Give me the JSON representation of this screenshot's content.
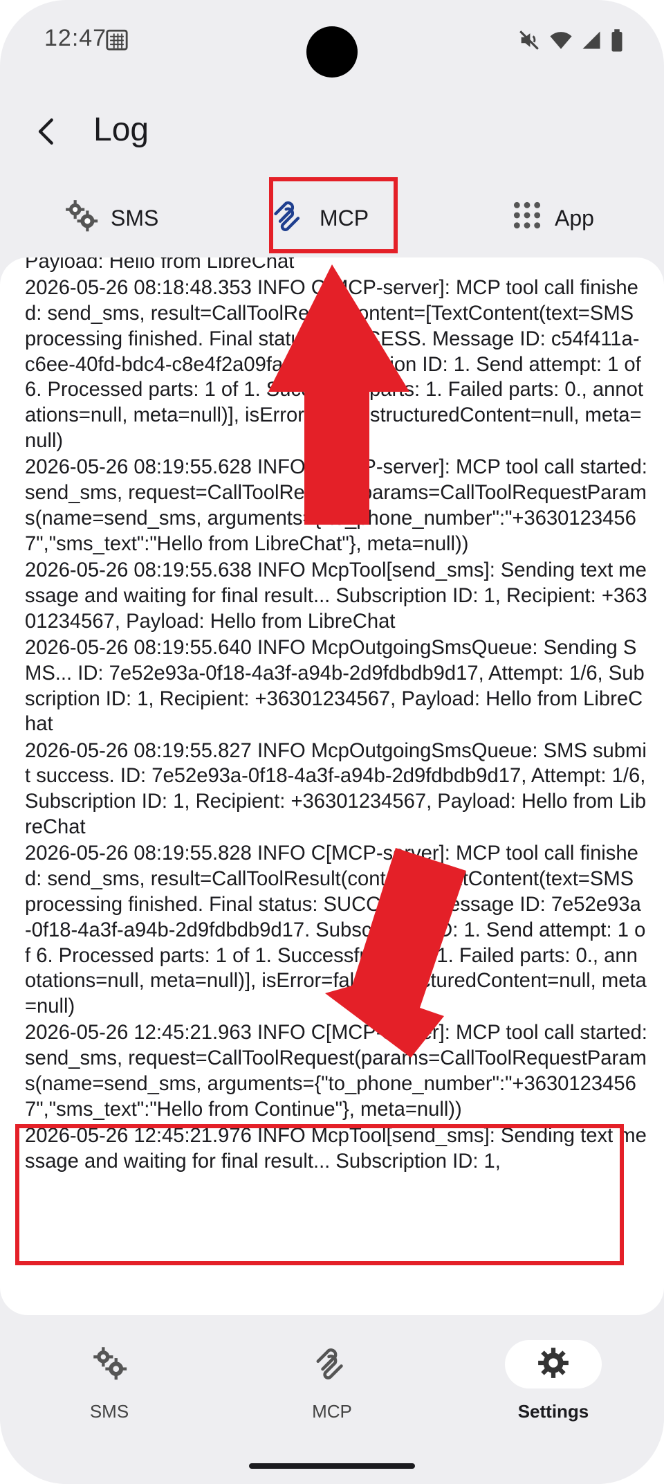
{
  "status_bar": {
    "time": "12:47"
  },
  "topbar": {
    "title": "Log"
  },
  "tabs": [
    {
      "label": "SMS",
      "icon": "gears-icon"
    },
    {
      "label": "MCP",
      "icon": "mcp-icon"
    },
    {
      "label": "App",
      "icon": "grid-icon"
    }
  ],
  "log": {
    "entries": [
      "Payload: Hello from LibreChat",
      "2026-05-26 08:18:48.353 INFO C[MCP-server]: MCP tool call finished: send_sms, result=CallToolResult(content=[TextContent(text=SMS processing finished. Final status: SUCCESS. Message ID: c54f411a-c6ee-40fd-bdc4-c8e4f2a09faa. Subscription ID: 1. Send attempt: 1 of 6. Processed parts: 1 of 1. Successful parts: 1. Failed parts: 0., annotations=null, meta=null)], isError=false, structuredContent=null, meta=null)",
      "2026-05-26 08:19:55.628 INFO C[MCP-server]: MCP tool call started: send_sms, request=CallToolRequest(params=CallToolRequestParams(name=send_sms, arguments={\"to_phone_number\":\"+36301234567\",\"sms_text\":\"Hello from LibreChat\"}, meta=null))",
      "2026-05-26 08:19:55.638 INFO McpTool[send_sms]: Sending text message and waiting for final result... Subscription ID: 1, Recipient: +36301234567, Payload: Hello from LibreChat",
      "2026-05-26 08:19:55.640 INFO McpOutgoingSmsQueue: Sending SMS... ID: 7e52e93a-0f18-4a3f-a94b-2d9fdbdb9d17, Attempt: 1/6, Subscription ID: 1, Recipient: +36301234567, Payload: Hello from LibreChat",
      "2026-05-26 08:19:55.827 INFO McpOutgoingSmsQueue: SMS submit success. ID: 7e52e93a-0f18-4a3f-a94b-2d9fdbdb9d17, Attempt: 1/6, Subscription ID: 1, Recipient: +36301234567, Payload: Hello from LibreChat",
      "2026-05-26 08:19:55.828 INFO C[MCP-server]: MCP tool call finished: send_sms, result=CallToolResult(content=[TextContent(text=SMS processing finished. Final status: SUCCESS. Message ID: 7e52e93a-0f18-4a3f-a94b-2d9fdbdb9d17. Subscription ID: 1. Send attempt: 1 of 6. Processed parts: 1 of 1. Successful parts: 1. Failed parts: 0., annotations=null, meta=null)], isError=false, structuredContent=null, meta=null)",
      "2026-05-26 12:45:21.963 INFO C[MCP-server]: MCP tool call started: send_sms, request=CallToolRequest(params=CallToolRequestParams(name=send_sms, arguments={\"to_phone_number\":\"+36301234567\",\"sms_text\":\"Hello from Continue\"}, meta=null))",
      "2026-05-26 12:45:21.976 INFO McpTool[send_sms]: Sending text message and waiting for final result... Subscription ID: 1,"
    ]
  },
  "bottom_nav": [
    {
      "label": "SMS",
      "icon": "gears-icon"
    },
    {
      "label": "MCP",
      "icon": "mcp-icon"
    },
    {
      "label": "Settings",
      "icon": "gear-icon",
      "selected": true
    }
  ],
  "colors": {
    "highlight": "#e42028",
    "mcp_tab_icon": "#1f3f8f",
    "background": "#eeeef1"
  }
}
